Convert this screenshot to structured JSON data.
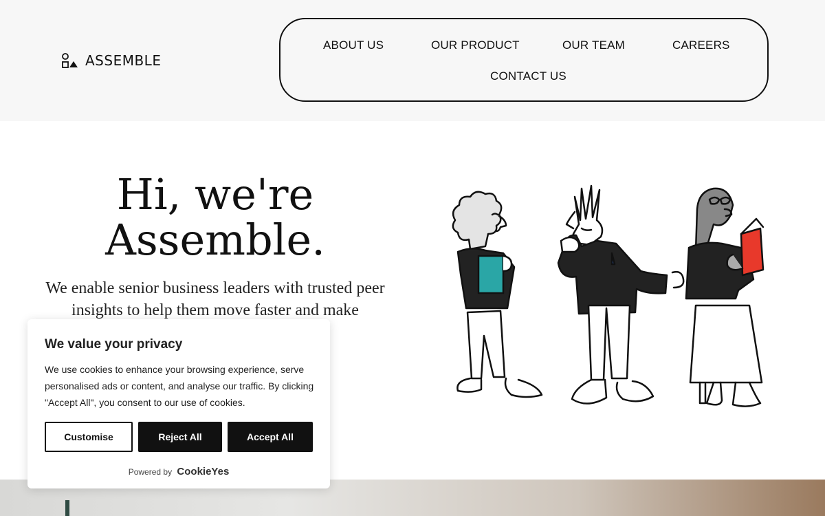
{
  "brand": {
    "name": "ASSEMBLE"
  },
  "nav": {
    "items": [
      {
        "label": "ABOUT US"
      },
      {
        "label": "OUR PRODUCT"
      },
      {
        "label": "OUR TEAM"
      },
      {
        "label": "CAREERS"
      },
      {
        "label": "CONTACT US"
      }
    ]
  },
  "hero": {
    "title": "Hi, we're Assemble.",
    "subtitle": "We enable senior business leaders with trusted peer insights to help them move faster and make"
  },
  "cookie_banner": {
    "title": "We value your privacy",
    "body": "We use cookies to enhance your browsing experience, serve personalised ads or content, and analyse our traffic. By clicking \"Accept All\", you consent to our use of cookies.",
    "customise_label": "Customise",
    "reject_label": "Reject All",
    "accept_label": "Accept All",
    "powered_by": "Powered by",
    "powered_brand": "CookieYes"
  },
  "colors": {
    "header_bg": "#f7f7f7",
    "text": "#111111",
    "button_dark": "#111111",
    "illustration_teal": "#2aa6a6",
    "illustration_red": "#e8392b"
  },
  "icons": {
    "logo": "assemble-shapes-logo-icon"
  }
}
